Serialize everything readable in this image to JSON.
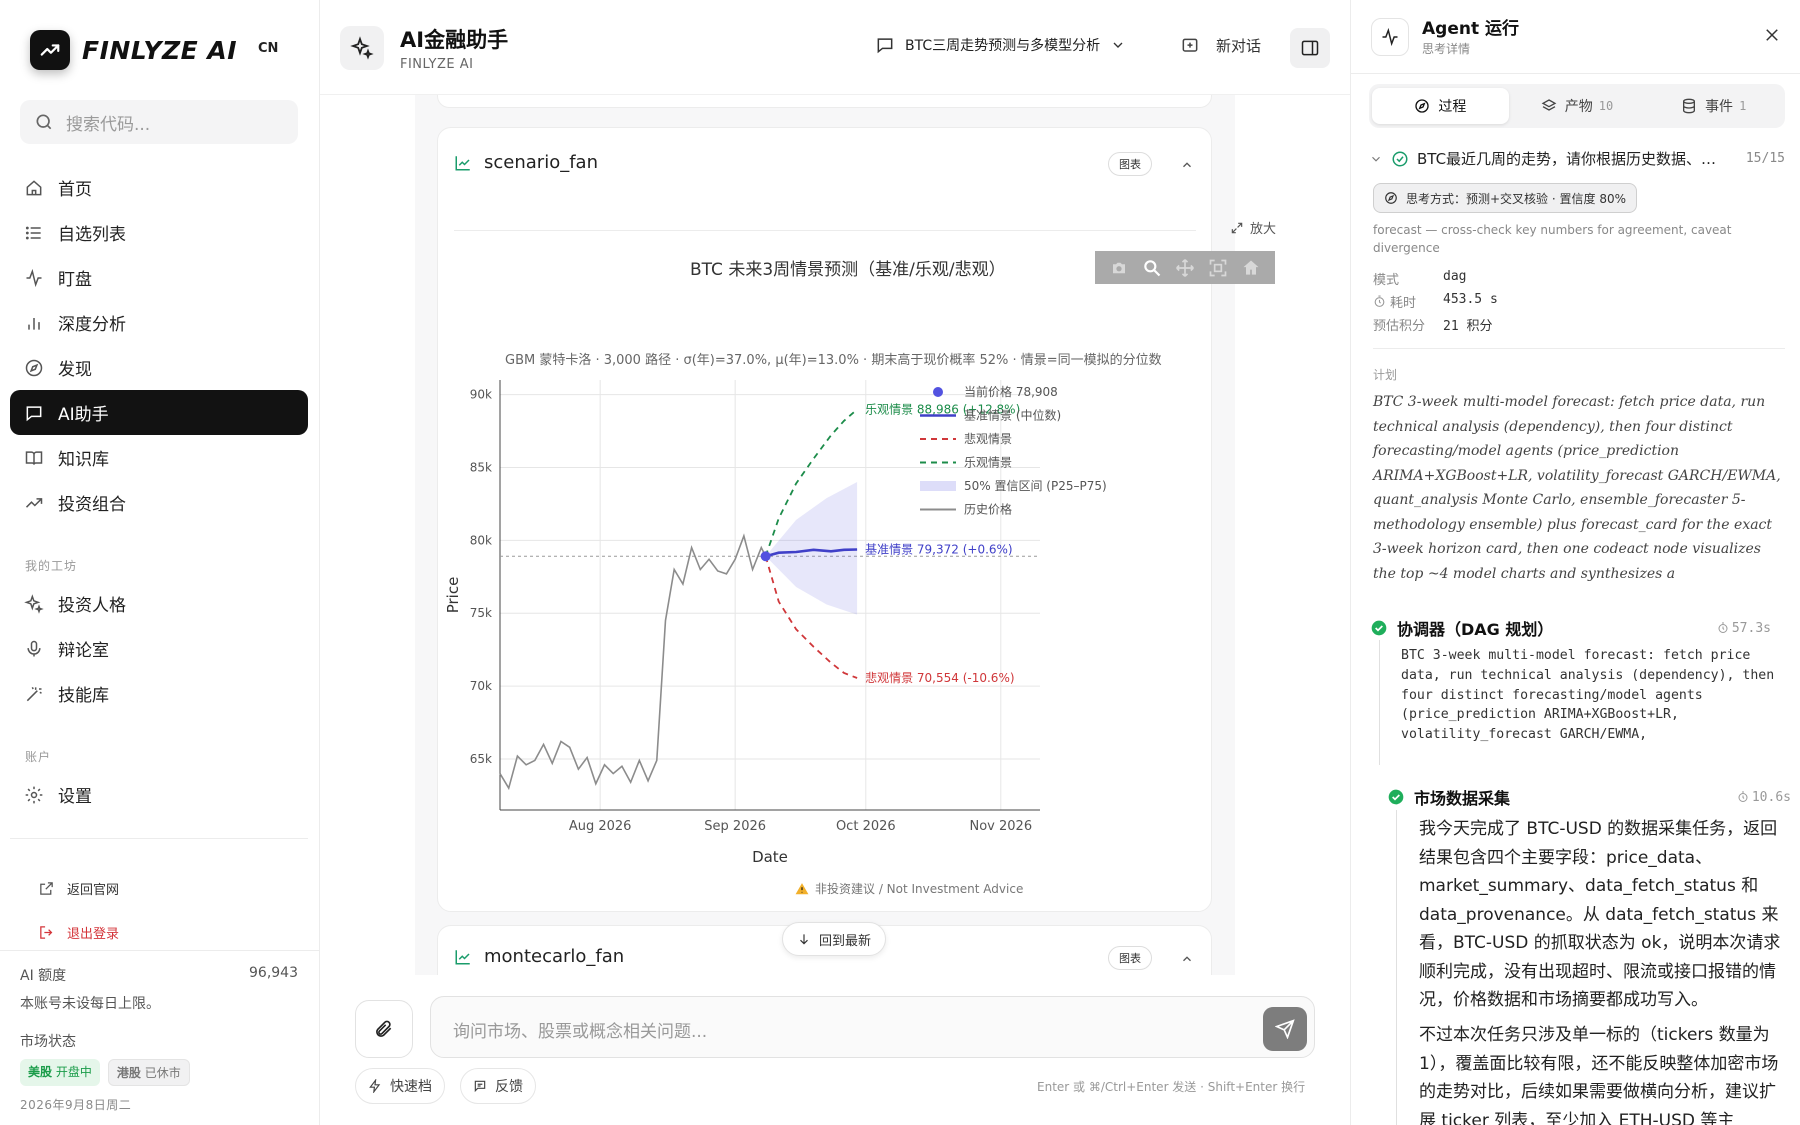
{
  "brand": {
    "name": "FINLYZE AI",
    "lang": "CN"
  },
  "search": {
    "placeholder": "搜索代码..."
  },
  "nav": {
    "items": [
      {
        "label": "首页",
        "icon": "home-icon"
      },
      {
        "label": "自选列表",
        "icon": "list-icon"
      },
      {
        "label": "盯盘",
        "icon": "pulse-icon"
      },
      {
        "label": "深度分析",
        "icon": "bar-chart-icon"
      },
      {
        "label": "发现",
        "icon": "compass-icon"
      },
      {
        "label": "AI助手",
        "icon": "chat-icon",
        "active": true
      },
      {
        "label": "知识库",
        "icon": "book-icon"
      },
      {
        "label": "投资组合",
        "icon": "trend-up-icon"
      }
    ],
    "workshop_label": "我的工坊",
    "workshop": [
      {
        "label": "投资人格",
        "icon": "sparkles-icon"
      },
      {
        "label": "辩论室",
        "icon": "mic-icon"
      },
      {
        "label": "技能库",
        "icon": "magic-wand-icon"
      }
    ],
    "account_label": "账户",
    "account": [
      {
        "label": "设置",
        "icon": "gear-icon"
      }
    ]
  },
  "links": {
    "back_site": "返回官网",
    "logout": "退出登录"
  },
  "quota": {
    "label": "AI 额度",
    "value": "96,943",
    "note": "本账号未设每日上限。",
    "market_label": "市场状态",
    "us": {
      "name": "美股",
      "status": "开盘中"
    },
    "hk": {
      "name": "港股",
      "status": "已休市"
    },
    "date": "2026年9月8日周二"
  },
  "header": {
    "title": "AI金融助手",
    "subtitle": "FINLYZE AI",
    "conversation": "BTC三周走势预测与多模型分析",
    "new_chat": "新对话"
  },
  "card": {
    "title": "scenario_fan",
    "tag": "图表",
    "expand": "放大",
    "warning": "非投资建议 / Not Investment Advice"
  },
  "card2": {
    "title": "montecarlo_fan",
    "tag": "图表"
  },
  "back_latest": "回到最新",
  "composer": {
    "placeholder": "询问市场、股票或概念相关问题...",
    "quick": "快速档",
    "feedback": "反馈",
    "hint": "Enter 或 ⌘/Ctrl+Enter 发送 · Shift+Enter 换行"
  },
  "chart_data": {
    "type": "line",
    "title": "BTC 未来3周情景预测（基准/乐观/悲观）",
    "subtitle": "GBM 蒙特卡洛 · 3,000 路径 · σ(年)=37.0%, μ(年)=13.0% · 期末高于现价概率 52% · 情景=同一模拟的分位数",
    "xlabel": "Date",
    "ylabel": "Price",
    "x_ticks": [
      "Aug 2026",
      "Sep 2026",
      "Oct 2026",
      "Nov 2026"
    ],
    "y_ticks": [
      "65k",
      "70k",
      "75k",
      "80k",
      "85k",
      "90k"
    ],
    "ylim": [
      61500,
      91000
    ],
    "xlim": [
      "2026-07-09",
      "2026-11-10"
    ],
    "grid": true,
    "legend_position": "right",
    "legend": [
      "当前价格 78,908",
      "基准情景 (中位数)",
      "悲观情景",
      "乐观情景",
      "50% 置信区间 (P25–P75)",
      "历史价格"
    ],
    "current_price": {
      "date": "2026-09-08",
      "value": 78908
    },
    "history": {
      "dates": [
        "2026-07-09",
        "2026-07-11",
        "2026-07-13",
        "2026-07-15",
        "2026-07-17",
        "2026-07-19",
        "2026-07-21",
        "2026-07-23",
        "2026-07-25",
        "2026-07-27",
        "2026-07-29",
        "2026-07-31",
        "2026-08-02",
        "2026-08-04",
        "2026-08-06",
        "2026-08-08",
        "2026-08-10",
        "2026-08-12",
        "2026-08-14",
        "2026-08-16",
        "2026-08-18",
        "2026-08-20",
        "2026-08-22",
        "2026-08-24",
        "2026-08-26",
        "2026-08-28",
        "2026-08-30",
        "2026-09-01",
        "2026-09-03",
        "2026-09-05",
        "2026-09-07",
        "2026-09-08"
      ],
      "values": [
        64000,
        63000,
        65200,
        64600,
        64900,
        66000,
        64700,
        66200,
        65800,
        64300,
        65100,
        63300,
        64600,
        64000,
        64500,
        63400,
        64900,
        63500,
        64900,
        74500,
        78000,
        77000,
        79500,
        78000,
        78700,
        77900,
        77700,
        78700,
        80300,
        78000,
        79500,
        78908
      ]
    },
    "scenarios": [
      {
        "name": "基准情景",
        "label": "基准情景 79,372 (+0.6%)",
        "color": "#4040c8",
        "dates": [
          "2026-09-08",
          "2026-09-11",
          "2026-09-15",
          "2026-09-19",
          "2026-09-23",
          "2026-09-26",
          "2026-09-29"
        ],
        "values": [
          78908,
          79150,
          79200,
          79350,
          79250,
          79350,
          79372
        ]
      },
      {
        "name": "乐观情景",
        "label": "乐观情景 88,986 (+12.8%)",
        "color": "#1c8c4a",
        "dates": [
          "2026-09-08",
          "2026-09-11",
          "2026-09-15",
          "2026-09-19",
          "2026-09-23",
          "2026-09-26",
          "2026-09-29"
        ],
        "values": [
          78908,
          81500,
          83900,
          85600,
          87200,
          88200,
          88986
        ]
      },
      {
        "name": "悲观情景",
        "label": "悲观情景 70,554 (-10.6%)",
        "color": "#d0373a",
        "dates": [
          "2026-09-08",
          "2026-09-11",
          "2026-09-15",
          "2026-09-19",
          "2026-09-23",
          "2026-09-26",
          "2026-09-29"
        ],
        "values": [
          78908,
          75800,
          73900,
          72700,
          71600,
          70900,
          70554
        ]
      }
    ],
    "band": {
      "dates": [
        "2026-09-08",
        "2026-09-15",
        "2026-09-22",
        "2026-09-29"
      ],
      "upper": [
        78908,
        81400,
        82900,
        84000
      ],
      "lower": [
        78908,
        76800,
        75600,
        74900
      ]
    }
  },
  "right": {
    "title": "Agent 运行",
    "subtitle": "思考详情",
    "tabs": [
      {
        "label": "过程",
        "count": ""
      },
      {
        "label": "产物",
        "count": "10"
      },
      {
        "label": "事件",
        "count": "1"
      }
    ],
    "task": "BTC最近几周的走势，请你根据历史数据、…",
    "progress": "15/15",
    "mode": "思考方式：预测+交叉核验 · 置信度 80%",
    "mode_desc": "forecast — cross-check key numbers for agreement, caveat divergence",
    "kv": [
      {
        "k": "模式",
        "v": "dag"
      },
      {
        "k": "耗时",
        "v": "453.5 s"
      },
      {
        "k": "预估积分",
        "v": "21 积分"
      }
    ],
    "plan_label": "计划",
    "plan": "BTC 3-week multi-model forecast: fetch price data, run technical analysis (dependency), then four distinct forecasting/model agents (price_prediction ARIMA+XGBoost+LR, volatility_forecast GARCH/EWMA, quant_analysis Monte Carlo, ensemble_forecaster 5-methodology ensemble) plus forecast_card for the exact 3-week horizon card, then one codeact node visualizes the top ~4 model charts and synthesizes a",
    "node1": {
      "title": "协调器（DAG 规划）",
      "time": "57.3s",
      "body": "BTC 3-week multi-model forecast: fetch price data, run technical analysis (dependency), then four distinct forecasting/model agents (price_prediction ARIMA+XGBoost+LR, volatility_forecast GARCH/EWMA,"
    },
    "node2": {
      "title": "市场数据采集",
      "time": "10.6s",
      "p1": "我今天完成了 BTC-USD 的数据采集任务，返回结果包含四个主要字段：price_data、market_summary、data_fetch_status 和 data_provenance。从 data_fetch_status 来看，BTC-USD 的抓取状态为 ok，说明本次请求顺利完成，没有出现超时、限流或接口报错的情况，价格数据和市场摘要都成功写入。",
      "p2": "不过本次任务只涉及单一标的（tickers 数量为 1），覆盖面比较有限，还不能反映整体加密市场的走势对比，后续如果需要做横向分析，建议扩展 ticker 列表，至少加入 ETH-USD 等主"
    }
  }
}
